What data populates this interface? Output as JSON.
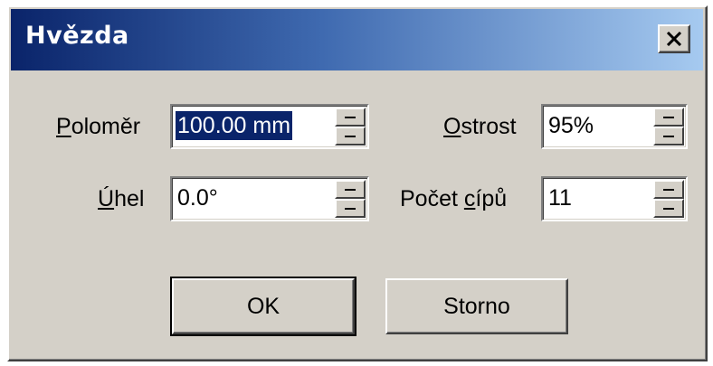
{
  "window": {
    "title": "Hvězda",
    "close_icon": "close-x-icon"
  },
  "fields": {
    "radius": {
      "label_accel": "P",
      "label_rest": "oloměr",
      "value": "100.00 mm"
    },
    "sharpness": {
      "label_accel": "O",
      "label_rest": "strost",
      "value": "95%"
    },
    "angle": {
      "label_accel": "Ú",
      "label_rest": "hel",
      "value": "0.0°"
    },
    "points": {
      "label_pre": "Počet ",
      "label_accel": "c",
      "label_rest": "ípů",
      "value": "11"
    }
  },
  "buttons": {
    "ok_label": "OK",
    "cancel_label": "Storno"
  },
  "colors": {
    "face": "#d4d0c8",
    "title_start": "#0a246a",
    "title_end": "#a6caf0",
    "selection": "#0a246a"
  }
}
